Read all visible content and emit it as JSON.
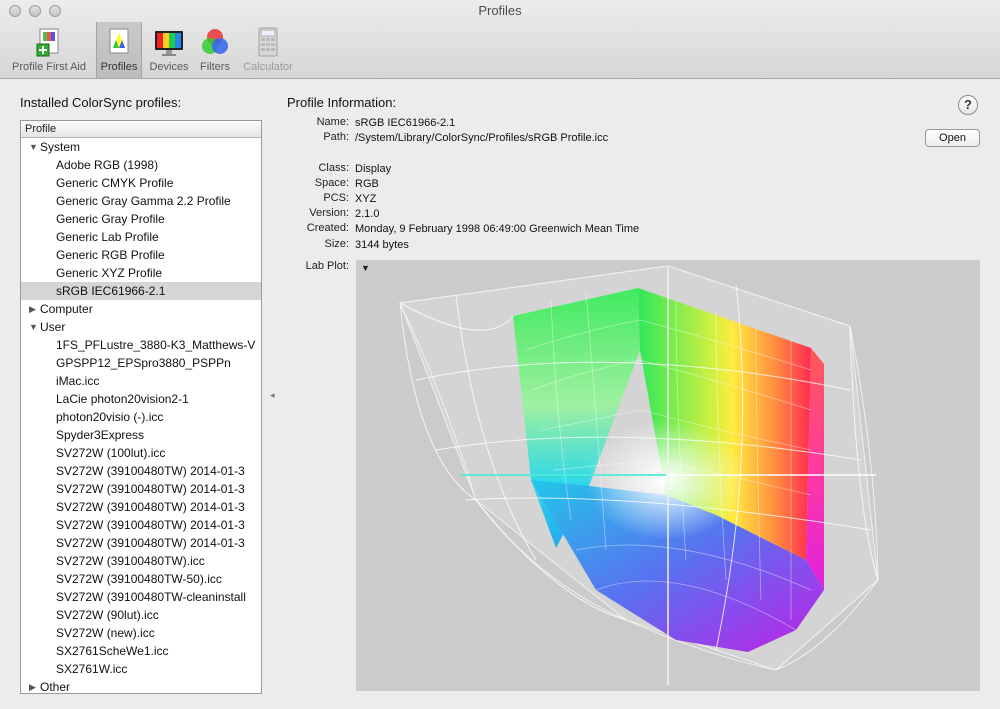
{
  "window": {
    "title": "Profiles"
  },
  "toolbar": {
    "items": [
      {
        "label": "Profile First Aid"
      },
      {
        "label": "Profiles"
      },
      {
        "label": "Devices"
      },
      {
        "label": "Filters"
      },
      {
        "label": "Calculator"
      }
    ]
  },
  "sidebar": {
    "heading": "Installed ColorSync profiles:",
    "column_header": "Profile",
    "rows": [
      {
        "type": "group",
        "label": "System",
        "expanded": true
      },
      {
        "type": "item",
        "label": "Adobe RGB (1998)"
      },
      {
        "type": "item",
        "label": "Generic CMYK Profile"
      },
      {
        "type": "item",
        "label": "Generic Gray Gamma 2.2 Profile"
      },
      {
        "type": "item",
        "label": "Generic Gray Profile"
      },
      {
        "type": "item",
        "label": "Generic Lab Profile"
      },
      {
        "type": "item",
        "label": "Generic RGB Profile"
      },
      {
        "type": "item",
        "label": "Generic XYZ Profile"
      },
      {
        "type": "item",
        "label": "sRGB IEC61966-2.1",
        "selected": true
      },
      {
        "type": "group",
        "label": "Computer",
        "expanded": false
      },
      {
        "type": "group",
        "label": "User",
        "expanded": true
      },
      {
        "type": "item",
        "label": "1FS_PFLustre_3880-K3_Matthews-V"
      },
      {
        "type": "item",
        "label": "GPSPP12_EPSpro3880_PSPPn"
      },
      {
        "type": "item",
        "label": "iMac.icc"
      },
      {
        "type": "item",
        "label": "LaCie photon20vision2-1"
      },
      {
        "type": "item",
        "label": "photon20visio (-).icc"
      },
      {
        "type": "item",
        "label": "Spyder3Express"
      },
      {
        "type": "item",
        "label": "SV272W (100lut).icc"
      },
      {
        "type": "item",
        "label": "SV272W (39100480TW) 2014-01-3"
      },
      {
        "type": "item",
        "label": "SV272W (39100480TW) 2014-01-3"
      },
      {
        "type": "item",
        "label": "SV272W (39100480TW) 2014-01-3"
      },
      {
        "type": "item",
        "label": "SV272W (39100480TW) 2014-01-3"
      },
      {
        "type": "item",
        "label": "SV272W (39100480TW) 2014-01-3"
      },
      {
        "type": "item",
        "label": "SV272W (39100480TW).icc"
      },
      {
        "type": "item",
        "label": "SV272W (39100480TW-50).icc"
      },
      {
        "type": "item",
        "label": "SV272W (39100480TW-cleaninstall"
      },
      {
        "type": "item",
        "label": "SV272W (90lut).icc"
      },
      {
        "type": "item",
        "label": "SV272W (new).icc"
      },
      {
        "type": "item",
        "label": "SX2761ScheWe1.icc"
      },
      {
        "type": "item",
        "label": "SX2761W.icc"
      },
      {
        "type": "group",
        "label": "Other",
        "expanded": false
      }
    ]
  },
  "info": {
    "heading": "Profile Information:",
    "help_label": "?",
    "open_label": "Open",
    "name_key": "Name:",
    "name": "sRGB IEC61966-2.1",
    "path_key": "Path:",
    "path": "/System/Library/ColorSync/Profiles/sRGB Profile.icc",
    "class_key": "Class:",
    "class": "Display",
    "space_key": "Space:",
    "space": "RGB",
    "pcs_key": "PCS:",
    "pcs": "XYZ",
    "version_key": "Version:",
    "version": "2.1.0",
    "created_key": "Created:",
    "created": "Monday, 9 February 1998 06:49:00 Greenwich Mean Time",
    "size_key": "Size:",
    "size": "3144 bytes",
    "labplot_key": "Lab Plot:"
  },
  "icons": {
    "close": "close-button-icon",
    "minimize": "minimize-button-icon",
    "zoom": "zoom-button-icon",
    "first_aid": "first-aid-icon",
    "profiles": "profiles-icon",
    "devices": "devices-icon",
    "filters": "filters-icon",
    "calculator": "calculator-icon",
    "expanded": "disclosure-down-icon",
    "collapsed": "disclosure-right-icon"
  },
  "colors": {
    "selection": "#d5d5d5",
    "plot_background": "#cbcbcb"
  }
}
